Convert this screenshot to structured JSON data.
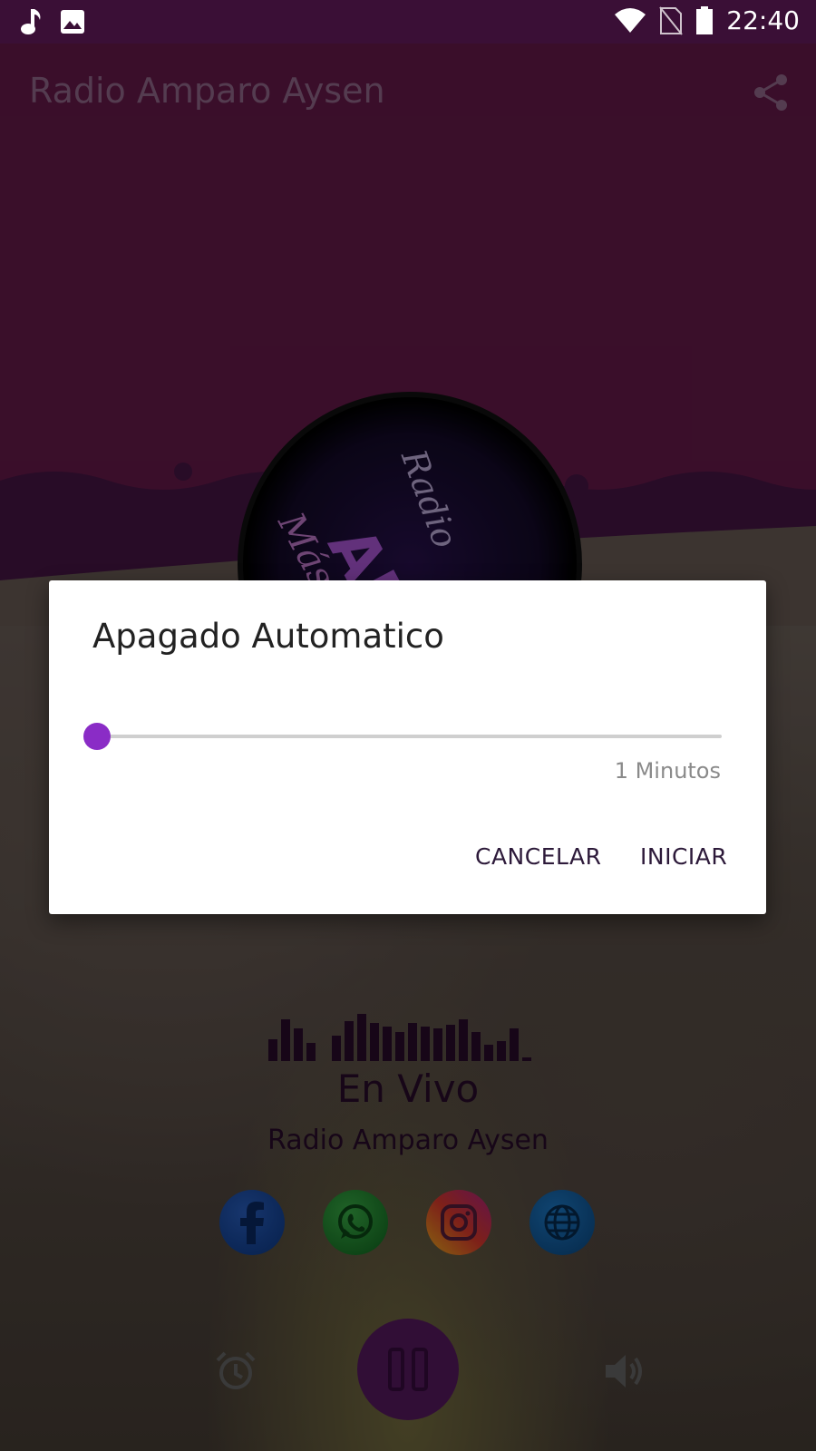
{
  "status_bar": {
    "time": "22:40",
    "icons": [
      "music-note-icon",
      "image-icon",
      "wifi-icon",
      "no-sim-icon",
      "battery-icon"
    ]
  },
  "toolbar": {
    "title": "Radio Amparo Aysen",
    "share_icon": "share-icon"
  },
  "logo": {
    "line1": "Radio",
    "line2": "AMPA",
    "line3": "Más qu"
  },
  "player": {
    "live_label": "En Vivo",
    "station_name": "Radio Amparo Aysen",
    "social": [
      "facebook-icon",
      "whatsapp-icon",
      "instagram-icon",
      "globe-icon"
    ],
    "controls": [
      "alarm-icon",
      "pause-icon",
      "volume-icon"
    ]
  },
  "dialog": {
    "title": "Apagado Automatico",
    "slider_value_label": "1 Minutos",
    "slider_fraction": 0.0,
    "cancel_label": "CANCELAR",
    "start_label": "INICIAR"
  },
  "colors": {
    "header_purple": "#6a1b4d",
    "status_bar": "#3a0f36",
    "accent": "#8a2cc6",
    "play_button": "#5a1a63"
  }
}
